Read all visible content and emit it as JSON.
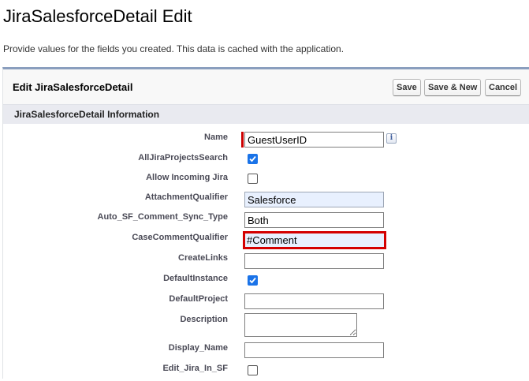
{
  "page": {
    "title": "JiraSalesforceDetail Edit",
    "description": "Provide values for the fields you created. This data is cached with the application."
  },
  "panel": {
    "title": "Edit JiraSalesforceDetail",
    "buttons": {
      "save": "Save",
      "save_new": "Save & New",
      "cancel": "Cancel"
    }
  },
  "section": {
    "title": "JiraSalesforceDetail Information"
  },
  "fields": {
    "name": {
      "label": "Name",
      "value": "GuestUserID",
      "required": true
    },
    "all_jira_projects_search": {
      "label": "AllJiraProjectsSearch",
      "checked": true
    },
    "allow_incoming_jira": {
      "label": "Allow Incoming Jira",
      "checked": false
    },
    "attachment_qualifier": {
      "label": "AttachmentQualifier",
      "value": "Salesforce"
    },
    "auto_sf_comment_sync_type": {
      "label": "Auto_SF_Comment_Sync_Type",
      "value": "Both"
    },
    "case_comment_qualifier": {
      "label": "CaseCommentQualifier",
      "value": "#Comment"
    },
    "create_links": {
      "label": "CreateLinks",
      "value": ""
    },
    "default_instance": {
      "label": "DefaultInstance",
      "checked": true
    },
    "default_project": {
      "label": "DefaultProject",
      "value": ""
    },
    "description": {
      "label": "Description",
      "value": ""
    },
    "display_name": {
      "label": "Display_Name",
      "value": ""
    },
    "edit_jira_in_sf": {
      "label": "Edit_Jira_In_SF",
      "checked": false
    }
  },
  "icons": {
    "info": "i"
  },
  "colors": {
    "panel_top_border": "#8a9ebe",
    "checkbox_checked": "#1a73e8",
    "required_bar": "#cc0000",
    "highlight_border": "#d40000"
  }
}
